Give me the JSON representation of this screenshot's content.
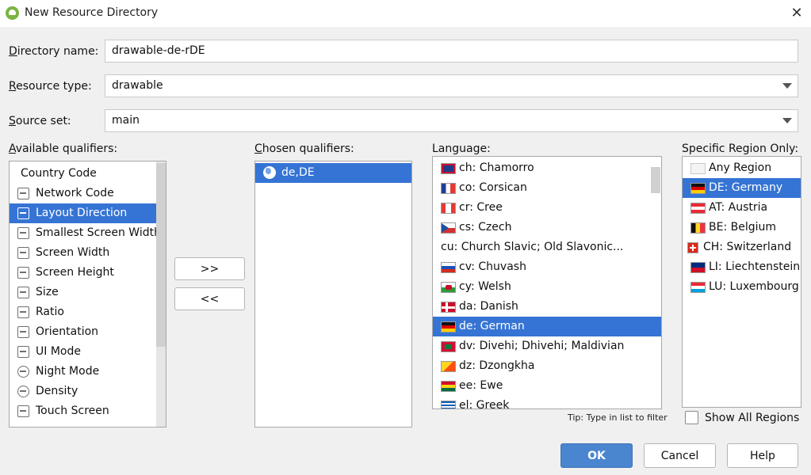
{
  "window": {
    "title": "New Resource Directory",
    "close_symbol": "✕"
  },
  "form": {
    "directory_name": {
      "label_mnemonic": "D",
      "label_rest": "irectory name:",
      "value": "drawable-de-rDE"
    },
    "resource_type": {
      "label_mnemonic": "R",
      "label_rest": "esource type:",
      "value": "drawable"
    },
    "source_set": {
      "label_mnemonic": "S",
      "label_rest": "ource set:",
      "value": "main"
    }
  },
  "available": {
    "label_mnemonic": "A",
    "label_rest": "vailable qualifiers:",
    "items": [
      {
        "label": "Country Code",
        "icon": "country-code-icon"
      },
      {
        "label": "Network Code",
        "icon": "network-code-icon"
      },
      {
        "label": "Layout Direction",
        "icon": "layout-direction-icon",
        "selected": true
      },
      {
        "label": "Smallest Screen Width",
        "icon": "smallest-screen-width-icon"
      },
      {
        "label": "Screen Width",
        "icon": "screen-width-icon"
      },
      {
        "label": "Screen Height",
        "icon": "screen-height-icon"
      },
      {
        "label": "Size",
        "icon": "size-icon"
      },
      {
        "label": "Ratio",
        "icon": "ratio-icon"
      },
      {
        "label": "Orientation",
        "icon": "orientation-icon"
      },
      {
        "label": "UI Mode",
        "icon": "ui-mode-icon"
      },
      {
        "label": "Night Mode",
        "icon": "night-mode-icon"
      },
      {
        "label": "Density",
        "icon": "density-icon"
      },
      {
        "label": "Touch Screen",
        "icon": "touch-screen-icon"
      }
    ]
  },
  "transfer": {
    "add_label": ">>",
    "remove_label": "<<"
  },
  "chosen": {
    "label_mnemonic": "C",
    "label_rest": "hosen qualifiers:",
    "items": [
      {
        "label": "de,DE",
        "icon": "globe-icon",
        "selected": true
      }
    ]
  },
  "language": {
    "label": "Language:",
    "items": [
      {
        "label": "ch: Chamorro",
        "flag": "guam"
      },
      {
        "label": "co: Corsican",
        "flag": "france"
      },
      {
        "label": "cr: Cree",
        "flag": "canada"
      },
      {
        "label": "cs: Czech",
        "flag": "czech"
      },
      {
        "label": "cu: Church Slavic; Old Slavonic...",
        "flag": ""
      },
      {
        "label": "cv: Chuvash",
        "flag": "russia"
      },
      {
        "label": "cy: Welsh",
        "flag": "wales"
      },
      {
        "label": "da: Danish",
        "flag": "denmark"
      },
      {
        "label": "de: German",
        "flag": "germany",
        "selected": true
      },
      {
        "label": "dv: Divehi; Dhivehi; Maldivian",
        "flag": "maldives"
      },
      {
        "label": "dz: Dzongkha",
        "flag": "bhutan"
      },
      {
        "label": "ee: Ewe",
        "flag": "ghana"
      },
      {
        "label": "el: Greek",
        "flag": "greece"
      }
    ],
    "tip": "Tip: Type in list to filter"
  },
  "region": {
    "label": "Specific Region Only:",
    "items": [
      {
        "label": "Any Region",
        "flag": "blank"
      },
      {
        "label": "DE: Germany",
        "flag": "germany",
        "selected": true
      },
      {
        "label": "AT: Austria",
        "flag": "austria"
      },
      {
        "label": "BE: Belgium",
        "flag": "belgium"
      },
      {
        "label": "CH: Switzerland",
        "flag": "switzerland"
      },
      {
        "label": "LI: Liechtenstein",
        "flag": "liechtenstein"
      },
      {
        "label": "LU: Luxembourg",
        "flag": "luxembourg"
      }
    ],
    "show_all_label": "Show All Regions"
  },
  "footer": {
    "ok_label": "OK",
    "cancel_label": "Cancel",
    "help_label": "Help"
  },
  "colors": {
    "selection": "#3574d4",
    "primary_button": "#4a86d0"
  }
}
